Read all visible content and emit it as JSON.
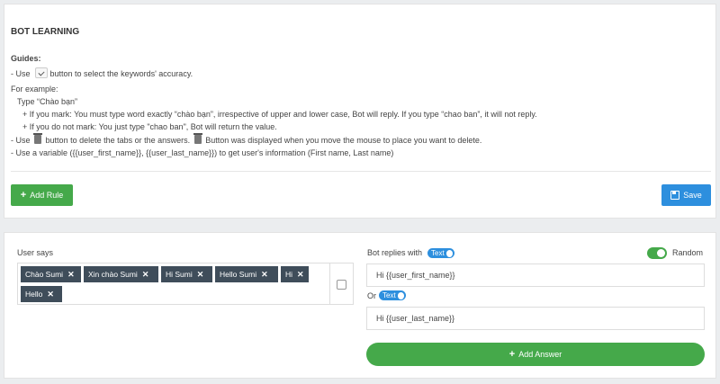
{
  "page_title": "BOT LEARNING",
  "guides": {
    "heading": "Guides:",
    "line_use_prefix": "- Use",
    "line_use_suffix": "button to select the keywords' accuracy.",
    "for_example": "For example:",
    "type_phrase": "Type “Chào bạn”",
    "if_mark": "+ If you mark: You must type word exactly “chào bạn”, irrespective of upper and lower case, Bot will reply. If you type “chao ban”, it will not reply.",
    "if_not_mark": "+ If you do not mark: You just type \"chao ban\", Bot will return the value.",
    "delete_prefix": "- Use",
    "delete_middle": "button to delete the tabs or the answers.",
    "delete_suffix": "Button was displayed when you move the mouse to place you want to delete.",
    "variable_line": "- Use a variable ({{user_first_name}}, {{user_last_name}}) to get user's information (First name, Last name)"
  },
  "buttons": {
    "add_rule": "Add Rule",
    "save": "Save",
    "add_answer": "Add Answer"
  },
  "rule": {
    "user_says_label": "User says",
    "tags": [
      "Chào Sumi",
      "Xin chào Sumi",
      "Hi Sumi",
      "Hello Sumi",
      "Hi",
      "Hello"
    ],
    "exact_match_checked": false,
    "bot_replies_label": "Bot replies with",
    "text_badge": "Text",
    "random_label": "Random",
    "random_on": true,
    "or_label": "Or",
    "answers": [
      "Hi {{user_first_name}}",
      "Hi {{user_last_name}}"
    ]
  },
  "colors": {
    "green": "#45a94a",
    "blue": "#2d8fde",
    "tag_bg": "#3f4d5a"
  },
  "icons": [
    "checkbox-icon",
    "trash-icon",
    "plus-icon",
    "save-icon",
    "close-icon"
  ]
}
